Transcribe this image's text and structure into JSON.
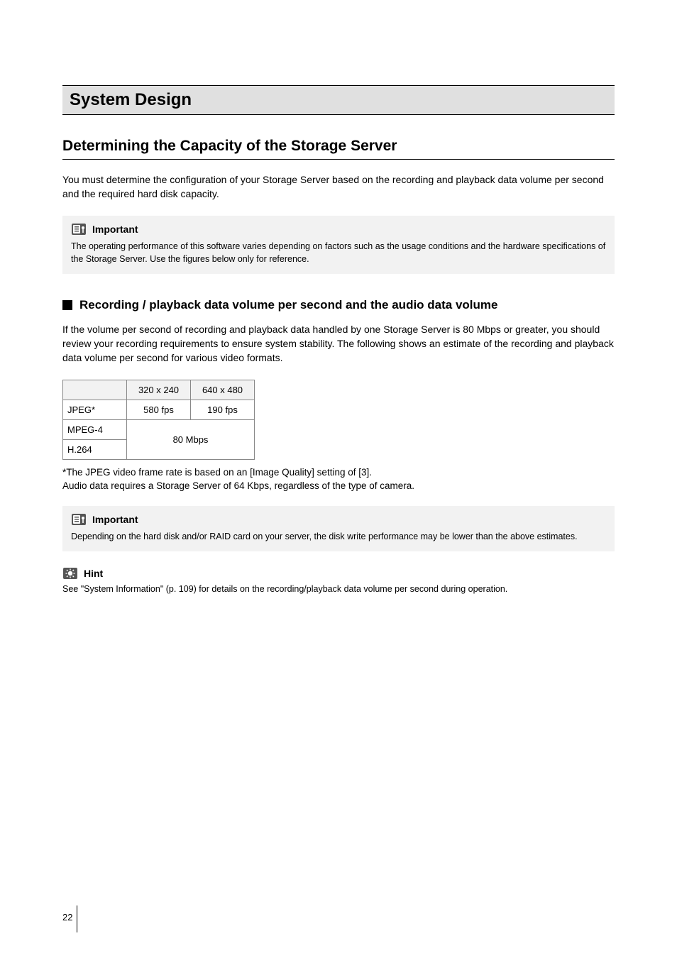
{
  "sectionTitle": "System Design",
  "subsectionTitle": "Determining the Capacity of the Storage Server",
  "intro": "You must determine the configuration of your Storage Server based on the recording and playback data volume per second and the required hard disk capacity.",
  "important1": {
    "label": "Important",
    "body": "The operating performance of this software varies depending on factors such as the usage conditions and the hardware specifications of the Storage Server. Use the figures below only for reference."
  },
  "bulletHeading": "Recording / playback data volume per second and the audio data volume",
  "bulletBody": "If the volume per second of recording and playback data handled by one Storage Server is 80 Mbps or greater, you should review your recording requirements to ensure system stability. The following shows an estimate of the recording and playback data volume per second for various video formats.",
  "table": {
    "headers": [
      "",
      "320 x 240",
      "640 x 480"
    ],
    "rows": [
      {
        "label": "JPEG*",
        "c1": "580 fps",
        "c2": "190 fps"
      },
      {
        "label": "MPEG-4",
        "merged": "80 Mbps"
      },
      {
        "label": "H.264"
      }
    ]
  },
  "footnote1": "*The JPEG video frame rate is based on an [Image Quality] setting of [3].",
  "footnote2": "Audio data requires a Storage Server of 64 Kbps, regardless of the type of camera.",
  "important2": {
    "label": "Important",
    "body": "Depending on the hard disk and/or RAID card on your server, the disk write performance may be lower than the above estimates."
  },
  "hint": {
    "label": "Hint",
    "body": "See \"System Information\" (p. 109) for details on the recording/playback data volume per second during operation."
  },
  "pageNumber": "22"
}
